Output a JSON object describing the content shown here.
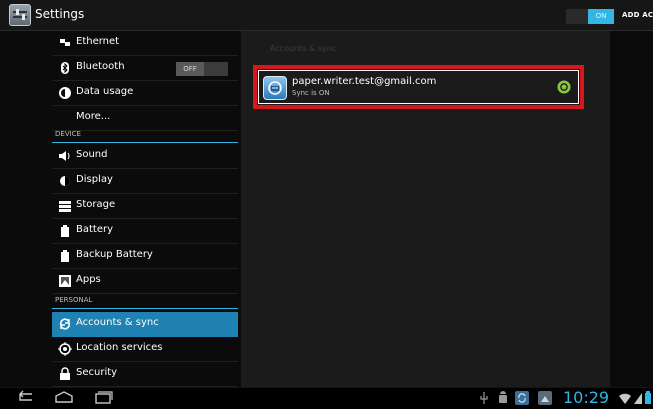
{
  "app": {
    "title": "Settings",
    "master_toggle": "ON",
    "add_account": "ADD ACCOUNT"
  },
  "list": {
    "items_wireless": [
      {
        "label": "Ethernet",
        "icon": "ethernet-icon"
      },
      {
        "label": "Bluetooth",
        "icon": "bluetooth-icon",
        "toggle": "OFF"
      },
      {
        "label": "Data usage",
        "icon": "data-usage-icon"
      },
      {
        "label": "More...",
        "icon": ""
      }
    ],
    "device_header": "DEVICE",
    "items_device": [
      {
        "label": "Sound",
        "icon": "sound-icon"
      },
      {
        "label": "Display",
        "icon": "display-icon"
      },
      {
        "label": "Storage",
        "icon": "storage-icon"
      },
      {
        "label": "Battery",
        "icon": "battery-icon"
      },
      {
        "label": "Backup Battery",
        "icon": "battery-icon"
      },
      {
        "label": "Apps",
        "icon": "apps-icon"
      }
    ],
    "personal_header": "PERSONAL",
    "items_personal": [
      {
        "label": "Accounts & sync",
        "icon": "sync-icon",
        "selected": true
      },
      {
        "label": "Location services",
        "icon": "location-icon"
      },
      {
        "label": "Security",
        "icon": "lock-icon"
      }
    ]
  },
  "pane": {
    "title": "Accounts & sync",
    "account": {
      "email": "paper.writer.test@gmail.com",
      "status": "Sync is ON"
    }
  },
  "status_bar": {
    "time": "10:29"
  },
  "colors": {
    "accent": "#33b5e5",
    "selected": "#1f82b2",
    "highlight_box": "#d6171d",
    "sync_green": "#8bc53f"
  }
}
